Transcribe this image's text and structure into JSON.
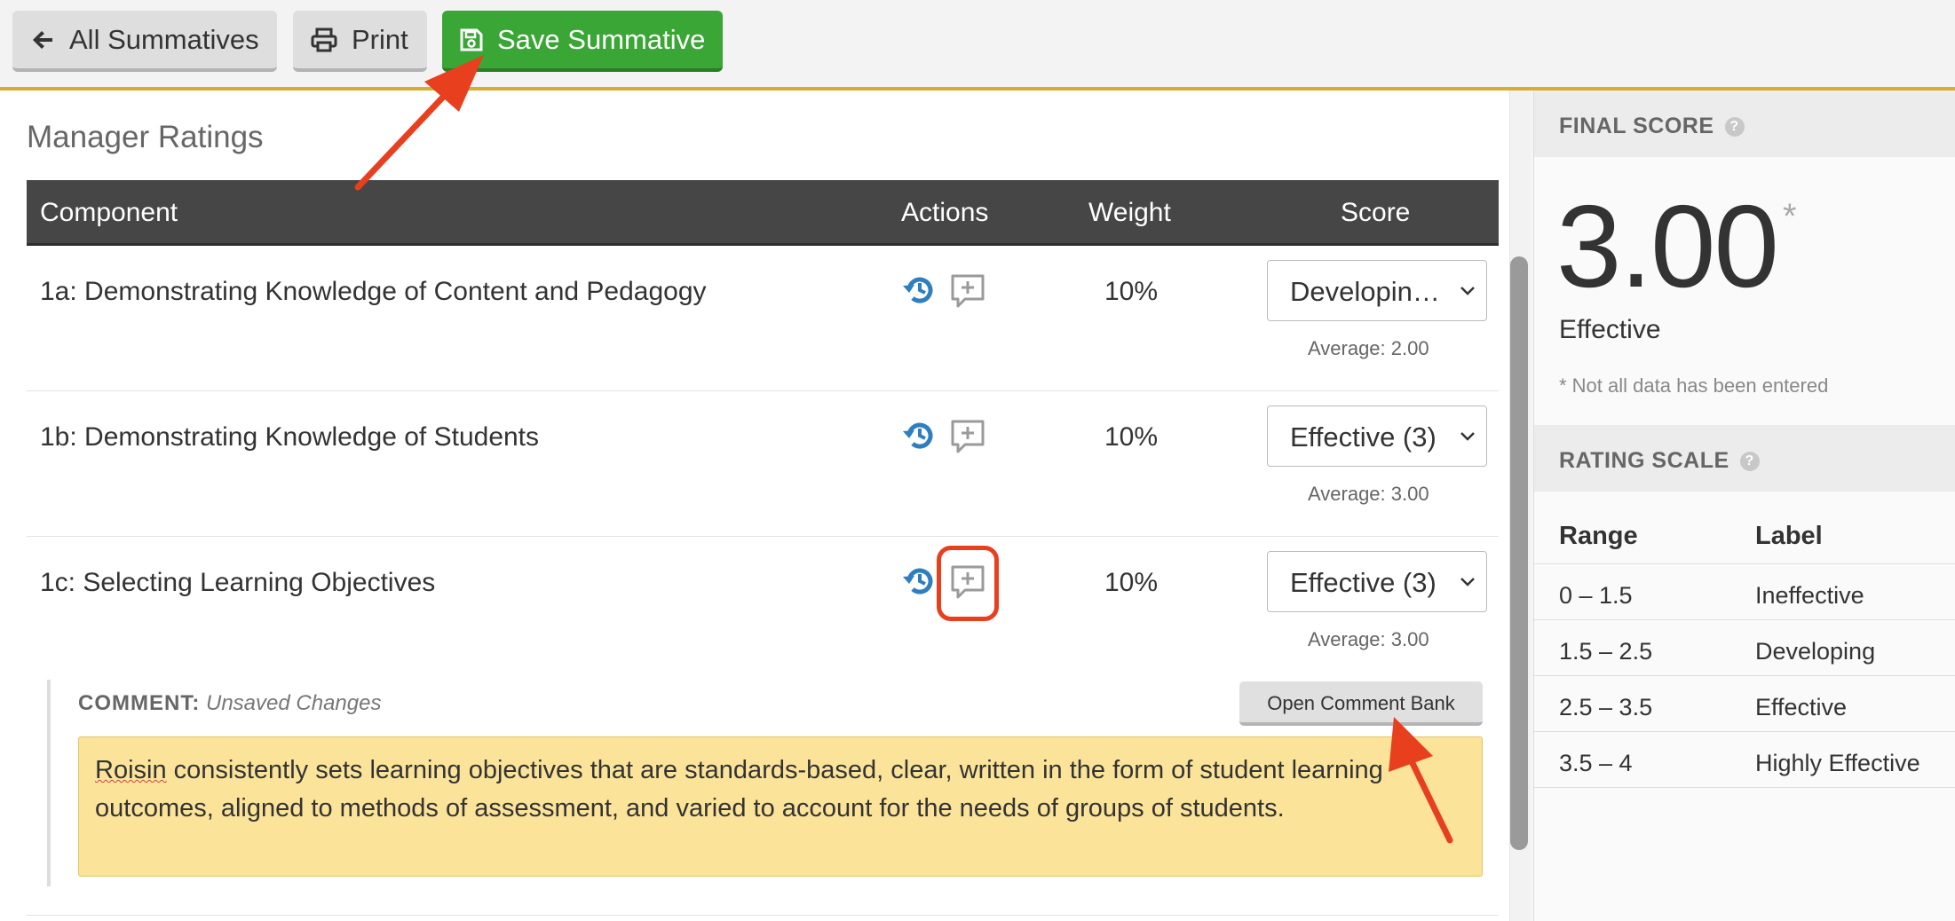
{
  "toolbar": {
    "all_summatives_label": "All Summatives",
    "print_label": "Print",
    "save_label": "Save Summative"
  },
  "main": {
    "section_title": "Manager Ratings",
    "columns": {
      "component": "Component",
      "actions": "Actions",
      "weight": "Weight",
      "score": "Score"
    },
    "rows": [
      {
        "name": "1a: Demonstrating Knowledge of Content and Pedagogy",
        "weight": "10%",
        "score": "Developin…",
        "average": "Average:  2.00"
      },
      {
        "name": "1b: Demonstrating Knowledge of Students",
        "weight": "10%",
        "score": "Effective (3)",
        "average": "Average:  3.00"
      },
      {
        "name": "1c: Selecting Learning Objectives",
        "weight": "10%",
        "score": "Effective (3)",
        "average": "Average:  3.00"
      }
    ],
    "comment": {
      "label": "COMMENT:",
      "status": "Unsaved Changes",
      "bank_button": "Open Comment Bank",
      "text_first": "Roisin",
      "text_rest": " consistently sets learning objectives that are standards-based, clear, written in the form of student learning outcomes, aligned to methods of assessment, and varied to account for the needs of groups of students."
    }
  },
  "side": {
    "final_score_header": "FINAL SCORE",
    "help_glyph": "?",
    "score": "3.00",
    "score_star": "*",
    "score_label": "Effective",
    "note": "* Not all data has been entered",
    "rating_scale_header": "RATING SCALE",
    "scale_columns": {
      "range": "Range",
      "label": "Label"
    },
    "scale_rows": [
      {
        "range": "0 – 1.5",
        "label": "Ineffective"
      },
      {
        "range": "1.5 – 2.5",
        "label": "Developing"
      },
      {
        "range": "2.5 – 3.5",
        "label": "Effective"
      },
      {
        "range": "3.5 – 4",
        "label": "Highly Effective"
      }
    ]
  },
  "colors": {
    "save_green": "#3aa635",
    "accent_gold": "#d6ae2b",
    "history_blue": "#2f7fc0",
    "annotation_red": "#e8401f",
    "comment_yellow": "#fbe49a"
  },
  "icons": {
    "back": "arrow-left-icon",
    "print": "printer-icon",
    "save": "floppy-disk-icon",
    "history": "history-icon",
    "comment": "comment-plus-icon",
    "dropdown": "chevron-down-icon",
    "help": "question-circle-icon"
  }
}
